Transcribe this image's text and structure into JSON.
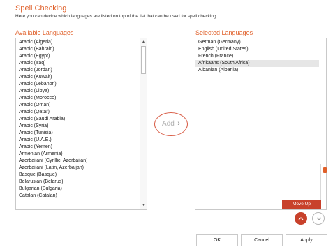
{
  "header": {
    "title": "Spell Checking",
    "subtitle": "Here you can decide which languages are listed on top of the list that can be used for spell checking."
  },
  "available": {
    "label": "Available Languages",
    "items": [
      "Arabic (Algeria)",
      "Arabic (Bahrain)",
      "Arabic (Egypt)",
      "Arabic (Iraq)",
      "Arabic (Jordan)",
      "Arabic (Kuwait)",
      "Arabic (Lebanon)",
      "Arabic (Libya)",
      "Arabic (Morocco)",
      "Arabic (Oman)",
      "Arabic (Qatar)",
      "Arabic (Saudi Arabia)",
      "Arabic (Syria)",
      "Arabic (Tunisia)",
      "Arabic (U.A.E.)",
      "Arabic (Yemen)",
      "Armenian (Armenia)",
      "Azerbaijani (Cyrillic, Azerbaijan)",
      "Azerbaijani (Latin, Azerbaijan)",
      "Basque (Basque)",
      "Belarusian (Belarus)",
      "Bulgarian (Bulgaria)",
      "Catalan (Catalan)"
    ]
  },
  "selected": {
    "label": "Selected Languages",
    "items": [
      "German (Germany)",
      "English (United States)",
      "French (France)",
      "Afrikaans (South Africa)",
      "Albanian (Albania)"
    ],
    "highlighted_index": 3
  },
  "add_button": {
    "label": "Add",
    "icon": "chevron-right-icon"
  },
  "tooltip": {
    "text": "Move Up"
  },
  "move_up_button": {
    "icon": "chevron-up-icon"
  },
  "move_down_button": {
    "icon": "chevron-down-icon"
  },
  "footer": {
    "ok_label": "OK",
    "cancel_label": "Cancel",
    "apply_label": "Apply"
  },
  "colors": {
    "accent": "#e0602a",
    "button_red": "#c8412b"
  }
}
